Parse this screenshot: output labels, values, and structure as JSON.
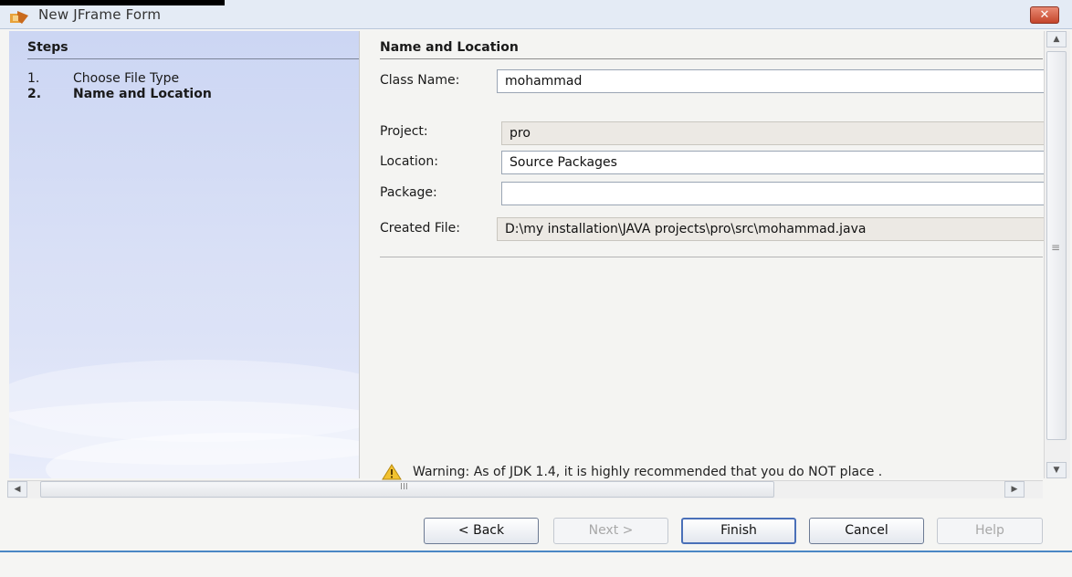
{
  "window": {
    "title": "New JFrame Form",
    "close_label": "✕"
  },
  "steps": {
    "title": "Steps",
    "items": [
      {
        "num": "1.",
        "label": "Choose File Type"
      },
      {
        "num": "2.",
        "label": "Name and Location"
      }
    ]
  },
  "form": {
    "section_title": "Name and Location",
    "class_name": {
      "label": "Class Name:",
      "value": "mohammad"
    },
    "project": {
      "label": "Project:",
      "value": "pro"
    },
    "location": {
      "label": "Location:",
      "value": "Source Packages"
    },
    "package": {
      "label": "Package:",
      "value": ""
    },
    "created_file": {
      "label": "Created File:",
      "value": "D:\\my installation\\JAVA projects\\pro\\src\\mohammad.java"
    }
  },
  "warning": {
    "text": "Warning: As of JDK 1.4, it is highly recommended that you do NOT place ."
  },
  "scrollbar": {
    "h_grip": "III",
    "v_grip": "≡"
  },
  "buttons": {
    "back": "< Back",
    "next": "Next >",
    "finish": "Finish",
    "cancel": "Cancel",
    "help": "Help"
  },
  "colors": {
    "accent": "#4a87c4",
    "steps_bg": "#ccd6f3",
    "warning": "#f2c230"
  }
}
